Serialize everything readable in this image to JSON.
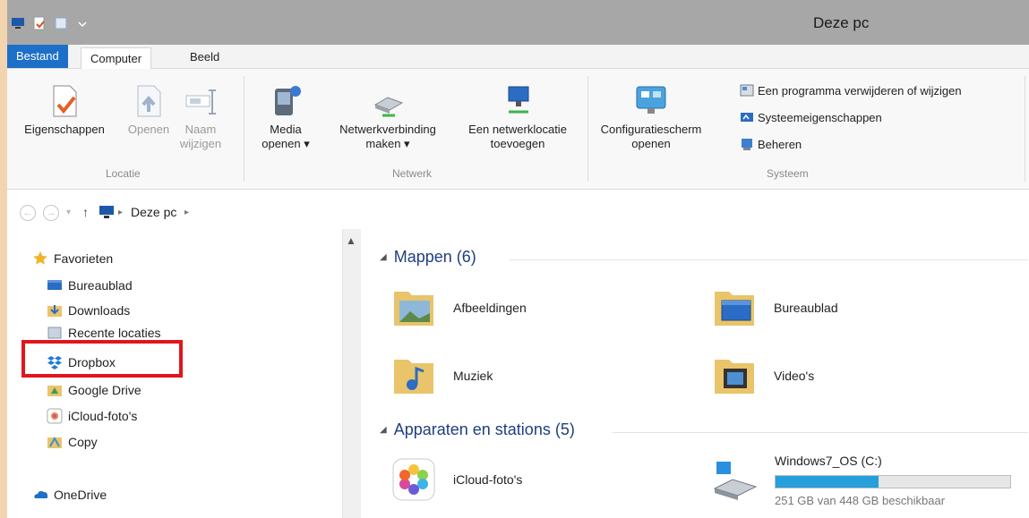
{
  "window": {
    "title": "Deze pc"
  },
  "ribbon": {
    "tabs": [
      {
        "label": "Bestand"
      },
      {
        "label": "Computer"
      },
      {
        "label": "Beeld"
      }
    ],
    "locatie": {
      "group_label": "Locatie",
      "eigenschappen": "Eigenschappen",
      "openen": "Openen",
      "naam_line1": "Naam",
      "naam_line2": "wijzigen"
    },
    "netwerk": {
      "group_label": "Netwerk",
      "media_line1": "Media",
      "media_line2": "openen ▾",
      "netverb_line1": "Netwerkverbinding",
      "netverb_line2": "maken ▾",
      "netloc_line1": "Een netwerklocatie",
      "netloc_line2": "toevoegen"
    },
    "systeem": {
      "group_label": "Systeem",
      "config_line1": "Configuratiescherm",
      "config_line2": "openen",
      "uninstall": "Een programma verwijderen of wijzigen",
      "sysprops": "Systeemeigenschappen",
      "beheren": "Beheren"
    }
  },
  "address": {
    "breadcrumb": "Deze pc",
    "sep": "▸"
  },
  "nav": {
    "items": [
      {
        "label": "Favorieten"
      },
      {
        "label": "Bureaublad"
      },
      {
        "label": "Downloads"
      },
      {
        "label": "Recente locaties"
      },
      {
        "label": "Dropbox"
      },
      {
        "label": "Google Drive"
      },
      {
        "label": "iCloud-foto's"
      },
      {
        "label": "Copy"
      },
      {
        "label": "OneDrive"
      }
    ]
  },
  "content": {
    "folders_header": "Mappen (6)",
    "folders": [
      {
        "label": "Afbeeldingen"
      },
      {
        "label": "Bureaublad"
      },
      {
        "label": "Muziek"
      },
      {
        "label": "Video's"
      }
    ],
    "devices_header": "Apparaten en stations (5)",
    "devices": [
      {
        "label": "iCloud-foto's"
      },
      {
        "label": "Windows7_OS (C:)",
        "free_text": "251 GB van 448 GB beschikbaar",
        "used_fraction": 0.44
      }
    ]
  },
  "colors": {
    "accent": "#1e6fc7",
    "highlight_box": "#e0161d",
    "drive_fill": "#26a0da"
  }
}
